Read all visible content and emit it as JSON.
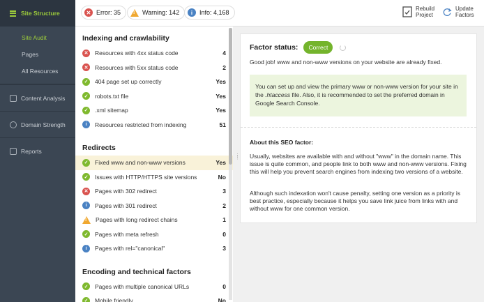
{
  "sidebar": {
    "title": "Site Structure",
    "sub_items": [
      "Site Audit",
      "Pages",
      "All Resources"
    ],
    "sections": [
      "Content Analysis",
      "Domain Strength",
      "Reports"
    ]
  },
  "topbar": {
    "error": "Error: 35",
    "warning": "Warning: 142",
    "info": "Info: 4,168",
    "rebuild_line1": "Rebuild",
    "rebuild_line2": "Project",
    "update_line1": "Update",
    "update_line2": "Factors"
  },
  "sections": [
    {
      "title": "Indexing and crawlability",
      "rows": [
        {
          "status": "error",
          "label": "Resources with 4xx status code",
          "value": "4"
        },
        {
          "status": "error",
          "label": "Resources with 5xx status code",
          "value": "2"
        },
        {
          "status": "ok",
          "label": "404 page set up correctly",
          "value": "Yes"
        },
        {
          "status": "ok",
          "label": "robots.txt file",
          "value": "Yes"
        },
        {
          "status": "ok",
          "label": ".xml sitemap",
          "value": "Yes"
        },
        {
          "status": "info",
          "label": "Resources restricted from indexing",
          "value": "51"
        }
      ]
    },
    {
      "title": "Redirects",
      "rows": [
        {
          "status": "ok",
          "label": "Fixed www and non-www versions",
          "value": "Yes",
          "selected": true
        },
        {
          "status": "ok",
          "label": "Issues with HTTP/HTTPS site versions",
          "value": "No"
        },
        {
          "status": "error",
          "label": "Pages with 302 redirect",
          "value": "3"
        },
        {
          "status": "info",
          "label": "Pages with 301 redirect",
          "value": "2"
        },
        {
          "status": "warn",
          "label": "Pages with long redirect chains",
          "value": "1"
        },
        {
          "status": "ok",
          "label": "Pages with meta refresh",
          "value": "0"
        },
        {
          "status": "info",
          "label": "Pages with rel=\"canonical\"",
          "value": "3"
        }
      ]
    },
    {
      "title": "Encoding and technical factors",
      "rows": [
        {
          "status": "ok",
          "label": "Pages with multiple canonical URLs",
          "value": "0"
        },
        {
          "status": "ok",
          "label": "Mobile friendly",
          "value": "No"
        }
      ]
    }
  ],
  "detail": {
    "factor_status_label": "Factor status:",
    "badge": "Correct",
    "message": "Good job! www and non-www versions on your website are already fixed.",
    "tip": "You can set up and view the primary www or non-www version for your site in the .htaccess file. Also, it is recommended to set the preferred domain in Google Search Console.",
    "about_title": "About this SEO factor:",
    "para1": "Usually, websites are available with and without \"www\" in the domain name. This issue is quite common, and people link to both www and non-www versions. Fixing this will help you prevent search engines from indexing two versions of a website.",
    "para2": "Although such indexation won't cause penalty, setting one version as a priority is best practice, especially because it helps you save link juice from links with and without www for one common version."
  },
  "colors": {
    "accent": "#9ccb3b",
    "error": "#d9534f",
    "ok": "#7fb92e",
    "info": "#4a82c3",
    "warning": "#f0a830"
  }
}
